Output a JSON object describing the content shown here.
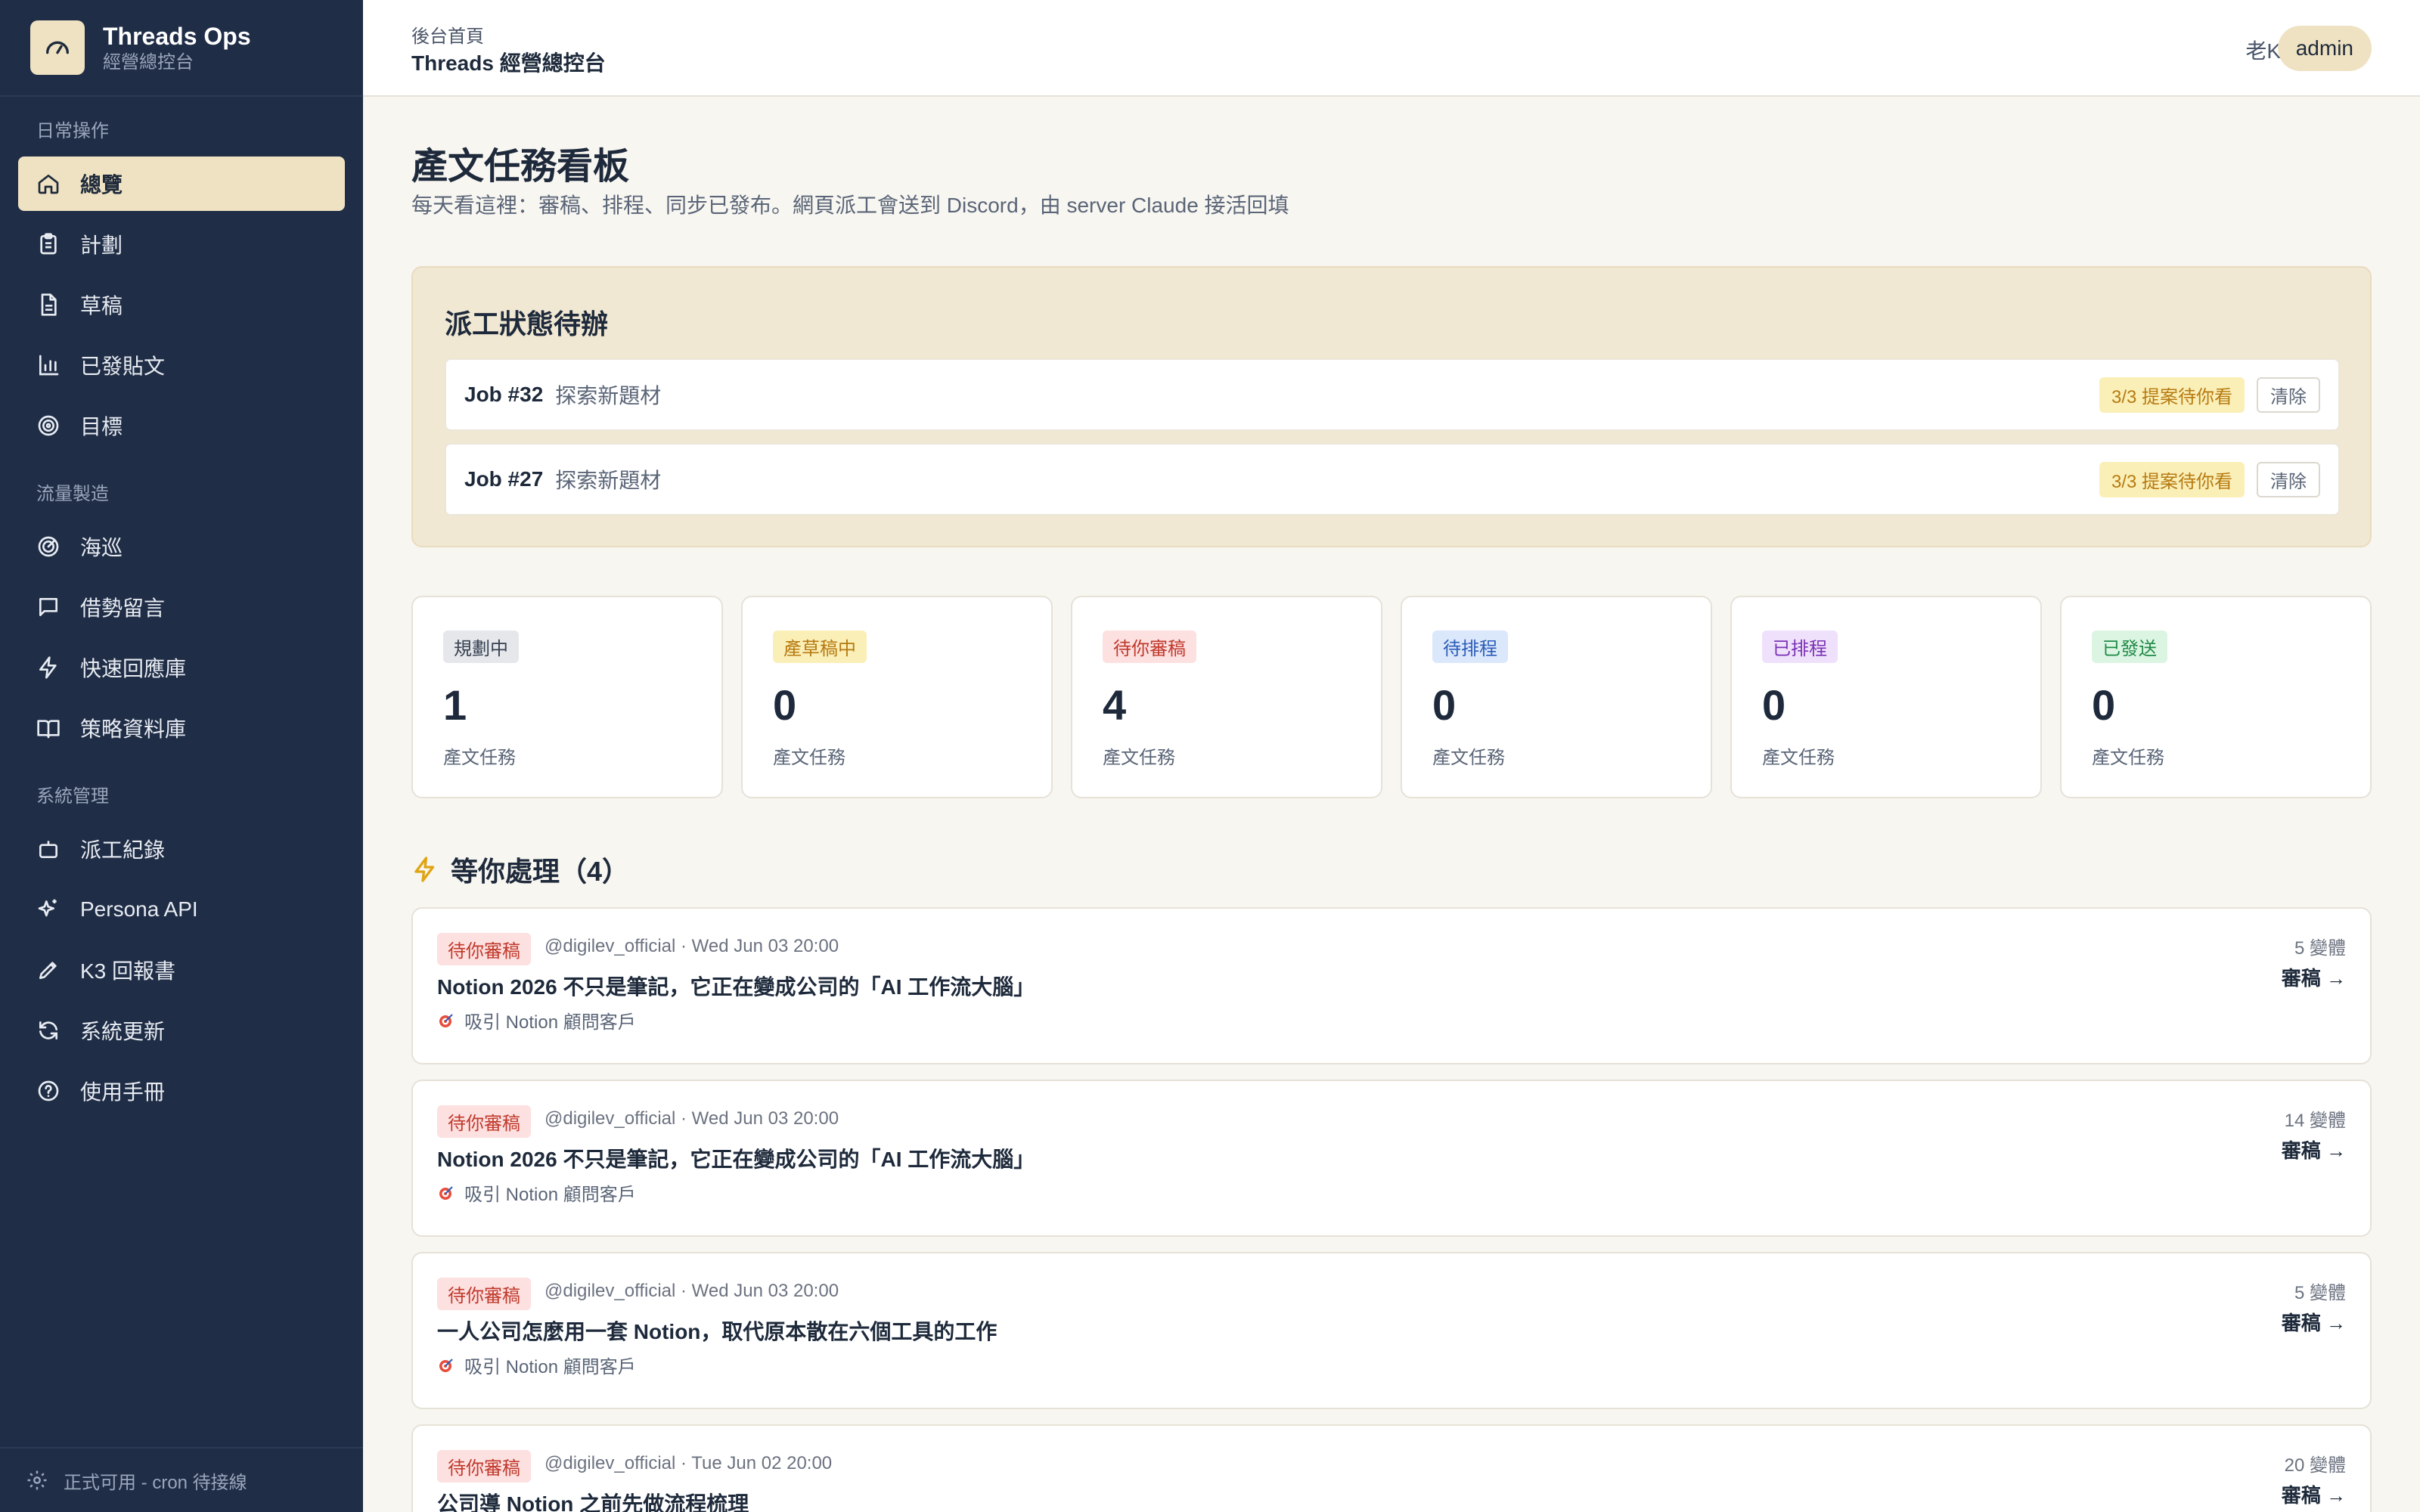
{
  "brand": {
    "title": "Threads Ops",
    "subtitle": "經營總控台"
  },
  "sidebar": {
    "sections": [
      "日常操作",
      "流量製造",
      "系統管理"
    ],
    "items": [
      {
        "label": "總覽",
        "icon": "home-icon",
        "active": true
      },
      {
        "label": "計劃",
        "icon": "clipboard-icon"
      },
      {
        "label": "草稿",
        "icon": "document-icon"
      },
      {
        "label": "已發貼文",
        "icon": "bar-chart-icon"
      },
      {
        "label": "目標",
        "icon": "target-icon"
      },
      {
        "label": "海巡",
        "icon": "radar-icon"
      },
      {
        "label": "借勢留言",
        "icon": "message-icon"
      },
      {
        "label": "快速回應庫",
        "icon": "lightning-icon"
      },
      {
        "label": "策略資料庫",
        "icon": "book-icon"
      },
      {
        "label": "派工紀錄",
        "icon": "robot-icon"
      },
      {
        "label": "Persona API",
        "icon": "sparkles-icon"
      },
      {
        "label": "K3 回報書",
        "icon": "pen-icon"
      },
      {
        "label": "系統更新",
        "icon": "refresh-icon"
      },
      {
        "label": "使用手冊",
        "icon": "help-icon"
      }
    ],
    "footer": "正式可用 - cron 待接線"
  },
  "header": {
    "breadcrumb": "後台首頁",
    "title": "Threads 經營總控台",
    "user": "老K",
    "role": "admin"
  },
  "page": {
    "title": "產文任務看板",
    "description": "每天看這裡：審稿、排程、同步已發布。網頁派工會送到 Discord，由 server Claude 接活回填"
  },
  "dispatch": {
    "title": "派工狀態待辦",
    "jobs": [
      {
        "id": "Job #32",
        "name": "探索新題材",
        "status": "3/3 提案待你看",
        "action": "清除"
      },
      {
        "id": "Job #27",
        "name": "探索新題材",
        "status": "3/3 提案待你看",
        "action": "清除"
      }
    ]
  },
  "stats": [
    {
      "label": "規劃中",
      "value": "1",
      "unit": "產文任務",
      "color": "#e5e7eb",
      "text": "#374151"
    },
    {
      "label": "產草稿中",
      "value": "0",
      "unit": "產文任務",
      "color": "#fbefb8",
      "text": "#b67a10"
    },
    {
      "label": "待你審稿",
      "value": "4",
      "unit": "產文任務",
      "color": "#fde0e0",
      "text": "#c0392b"
    },
    {
      "label": "待排程",
      "value": "0",
      "unit": "產文任務",
      "color": "#dbe7fb",
      "text": "#2b5db8"
    },
    {
      "label": "已排程",
      "value": "0",
      "unit": "產文任務",
      "color": "#efe0fb",
      "text": "#7a32b5"
    },
    {
      "label": "已發送",
      "value": "0",
      "unit": "產文任務",
      "color": "#dcf5e3",
      "text": "#1f8a46"
    }
  ],
  "waiting": {
    "title": "等你處理（4）",
    "tasks": [
      {
        "status": "待你審稿",
        "meta": "@digilev_official · Wed Jun 03 20:00",
        "title": "Notion 2026 不只是筆記，它正在變成公司的「AI 工作流大腦」",
        "goal": "吸引 Notion 顧問客戶",
        "variants": "5 變體",
        "action": "審稿 →"
      },
      {
        "status": "待你審稿",
        "meta": "@digilev_official · Wed Jun 03 20:00",
        "title": "Notion 2026 不只是筆記，它正在變成公司的「AI 工作流大腦」",
        "goal": "吸引 Notion 顧問客戶",
        "variants": "14 變體",
        "action": "審稿 →"
      },
      {
        "status": "待你審稿",
        "meta": "@digilev_official · Wed Jun 03 20:00",
        "title": "一人公司怎麼用一套 Notion，取代原本散在六個工具的工作",
        "goal": "吸引 Notion 顧問客戶",
        "variants": "5 變體",
        "action": "審稿 →"
      },
      {
        "status": "待你審稿",
        "meta": "@digilev_official · Tue Jun 02 20:00",
        "title": "公司導 Notion 之前先做流程梳理",
        "goal": "",
        "variants": "20 變體",
        "action": "審稿 →"
      }
    ]
  }
}
